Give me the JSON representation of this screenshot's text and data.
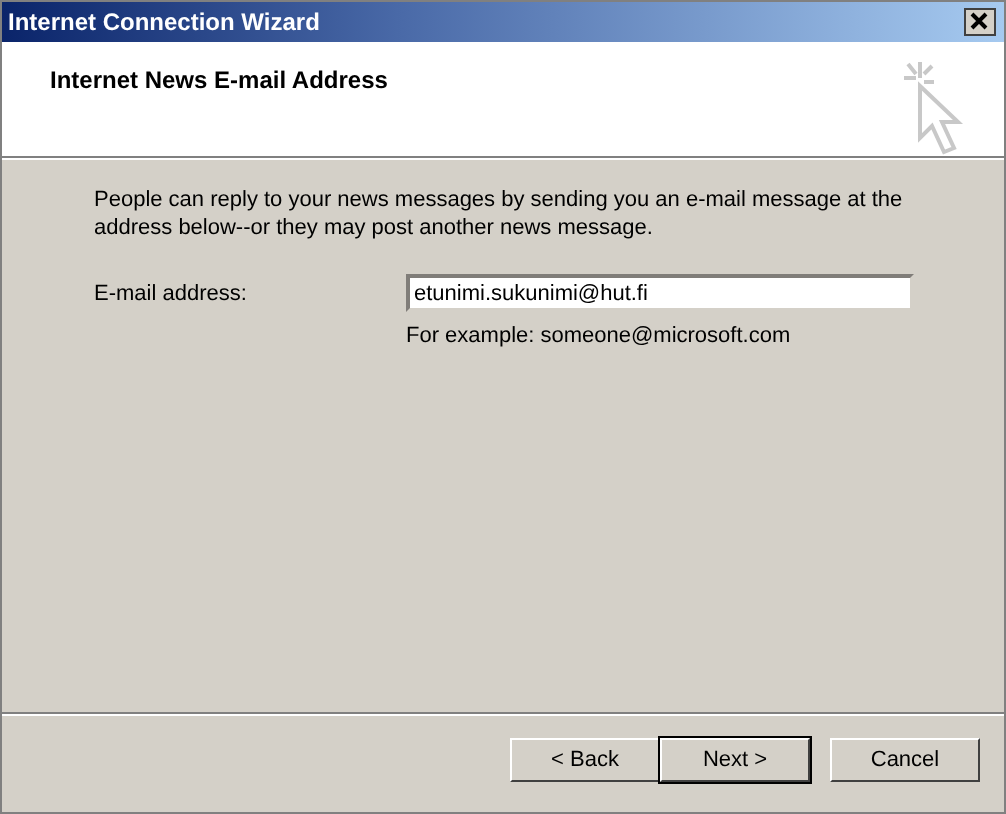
{
  "window": {
    "title": "Internet Connection Wizard"
  },
  "header": {
    "title": "Internet News E-mail Address"
  },
  "body": {
    "description": "People can reply to your news messages by sending you an e-mail message at the address below--or they may post another news message.",
    "field": {
      "label": "E-mail address:",
      "value": "etunimi.sukunimi@hut.fi"
    },
    "example": "For example: someone@microsoft.com"
  },
  "buttons": [
    {
      "label": "< Back",
      "default": false
    },
    {
      "label": "Next >",
      "default": true
    },
    {
      "label": "Cancel",
      "default": false
    }
  ]
}
